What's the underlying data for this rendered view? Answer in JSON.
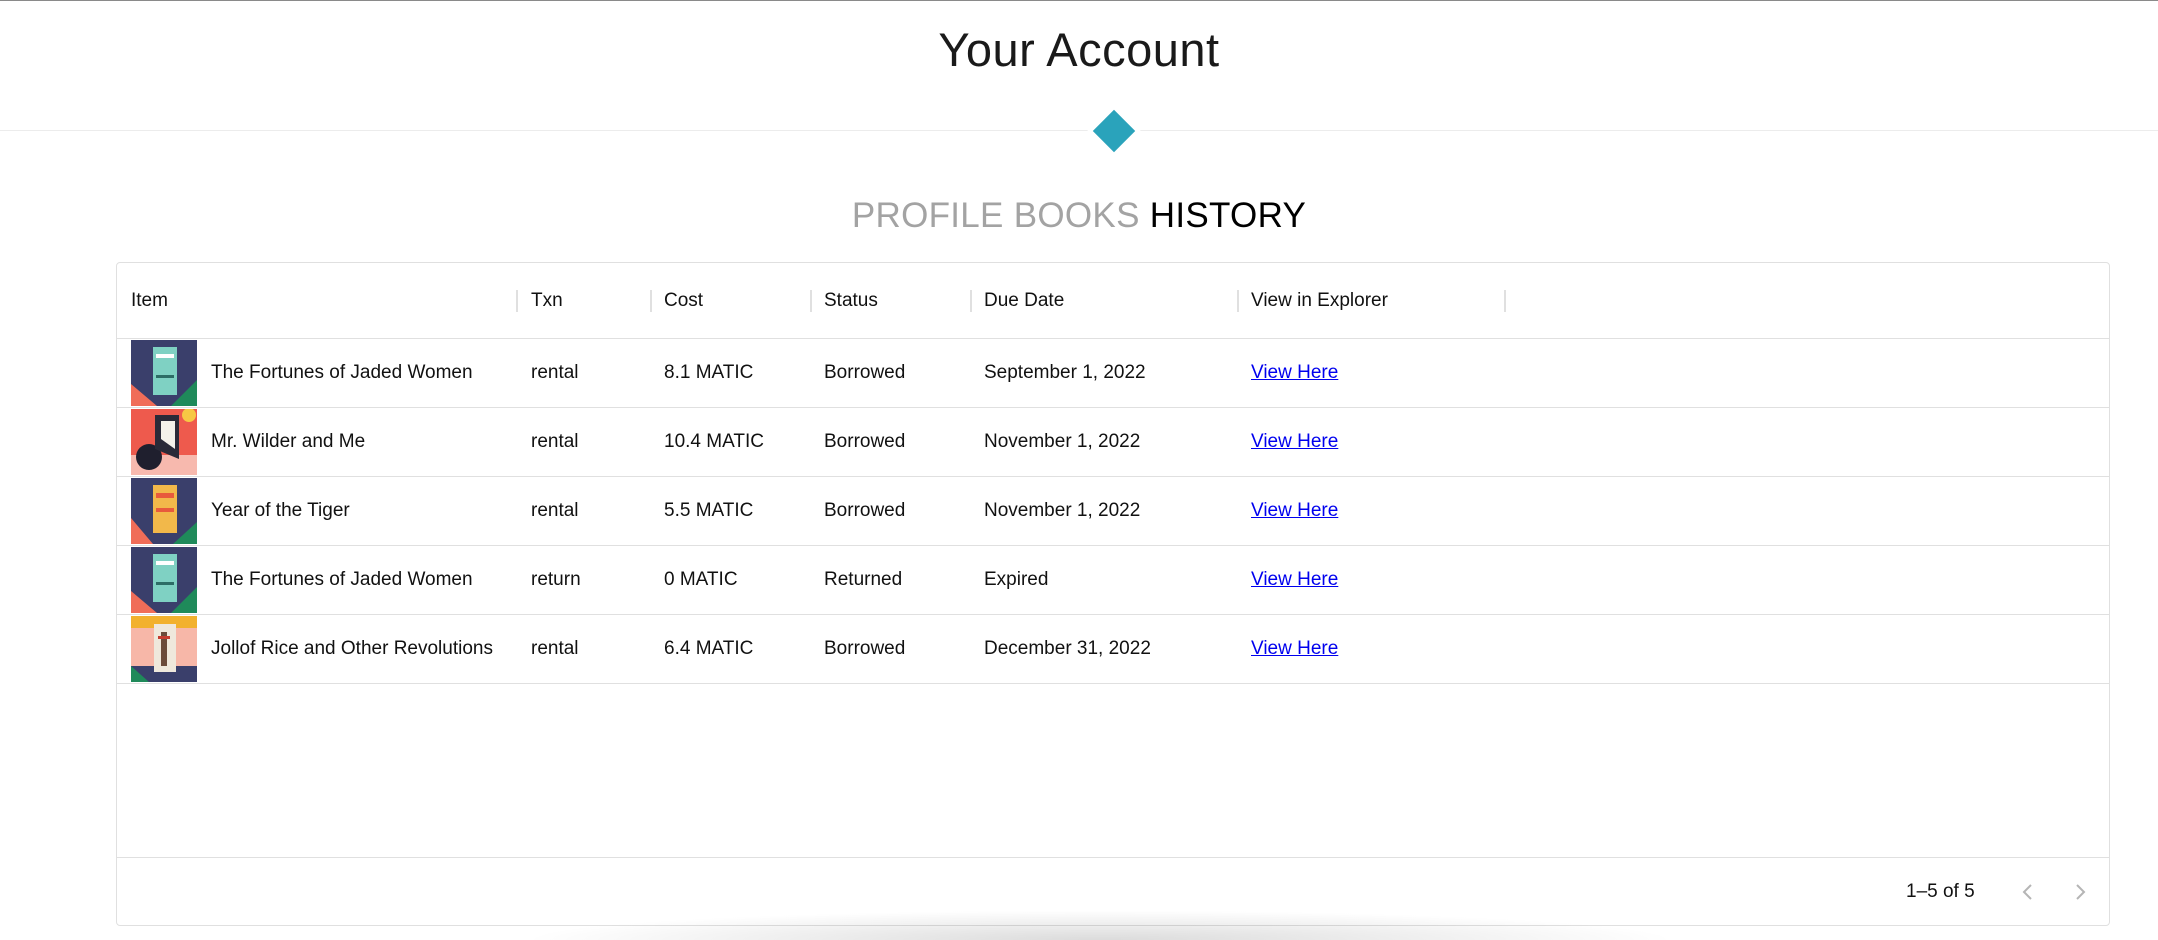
{
  "page": {
    "title": "Your Account"
  },
  "tabs": [
    {
      "label": "PROFILE",
      "active": false
    },
    {
      "label": "BOOKS",
      "active": false
    },
    {
      "label": "HISTORY",
      "active": true
    }
  ],
  "colors": {
    "accent": "#2aa3bb",
    "link": "#0000ee",
    "inactive_tab": "#a3a3a3"
  },
  "table": {
    "columns": [
      "Item",
      "Txn",
      "Cost",
      "Status",
      "Due Date",
      "View in Explorer"
    ],
    "rows": [
      {
        "cover": "fortunes-cover",
        "item": "The Fortunes of Jaded Women",
        "txn": "rental",
        "cost": "8.1 MATIC",
        "status": "Borrowed",
        "due": "September 1, 2022",
        "link": "View Here"
      },
      {
        "cover": "wilder-cover",
        "item": "Mr. Wilder and Me",
        "txn": "rental",
        "cost": "10.4 MATIC",
        "status": "Borrowed",
        "due": "November 1, 2022",
        "link": "View Here"
      },
      {
        "cover": "tiger-cover",
        "item": "Year of the Tiger",
        "txn": "rental",
        "cost": "5.5 MATIC",
        "status": "Borrowed",
        "due": "November 1, 2022",
        "link": "View Here"
      },
      {
        "cover": "fortunes-cover",
        "item": "The Fortunes of Jaded Women",
        "txn": "return",
        "cost": "0 MATIC",
        "status": "Returned",
        "due": "Expired",
        "link": "View Here"
      },
      {
        "cover": "jollof-cover",
        "item": "Jollof Rice and Other Revolutions",
        "txn": "rental",
        "cost": "6.4 MATIC",
        "status": "Borrowed",
        "due": "December 31, 2022",
        "link": "View Here"
      }
    ]
  },
  "pagination": {
    "range": "1–5 of 5",
    "prev_icon": "chevron-left-icon",
    "next_icon": "chevron-right-icon"
  }
}
